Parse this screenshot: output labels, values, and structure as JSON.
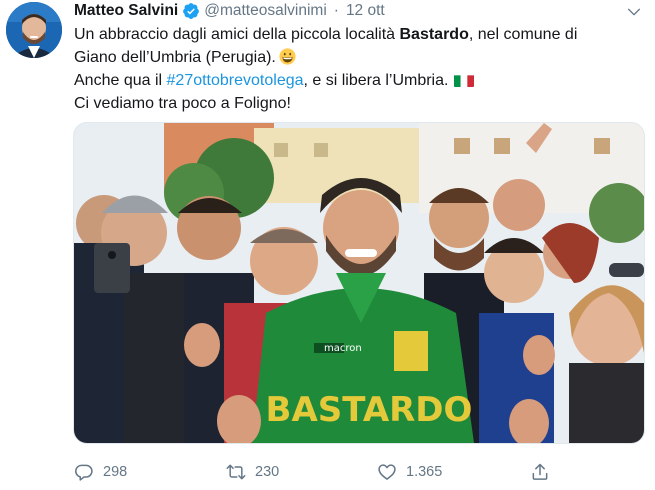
{
  "author": {
    "name": "Matteo Salvini",
    "handle": "@matteosalvinimi",
    "separator": "·",
    "timestamp": "12 ott",
    "verified": true
  },
  "tweet": {
    "line1_pre": "Un abbraccio dagli amici della piccola località ",
    "line1_bold": "Bastardo",
    "line1_post": ", nel comune di",
    "line2": "Giano dell’Umbria (Perugia).",
    "line3_pre": "Anche qua il ",
    "line3_hashtag": "#27ottobrevotolega",
    "line3_post": ", e si libera l’Umbria.",
    "line4": "Ci vediamo tra poco a Foligno!",
    "emojis": [
      "grinning-face-emoji",
      "italian-flag-emoji"
    ]
  },
  "photo": {
    "shirt_brand": "macron",
    "shirt_text": "BASTARDO"
  },
  "actions": {
    "reply_count": "298",
    "retweet_count": "230",
    "like_count": "1.365"
  },
  "colors": {
    "accent": "#1b95e0",
    "muted": "#657786",
    "text": "#14171a",
    "shirt_green": "#1f8a3a",
    "shirt_yellow": "#e4c93a"
  }
}
